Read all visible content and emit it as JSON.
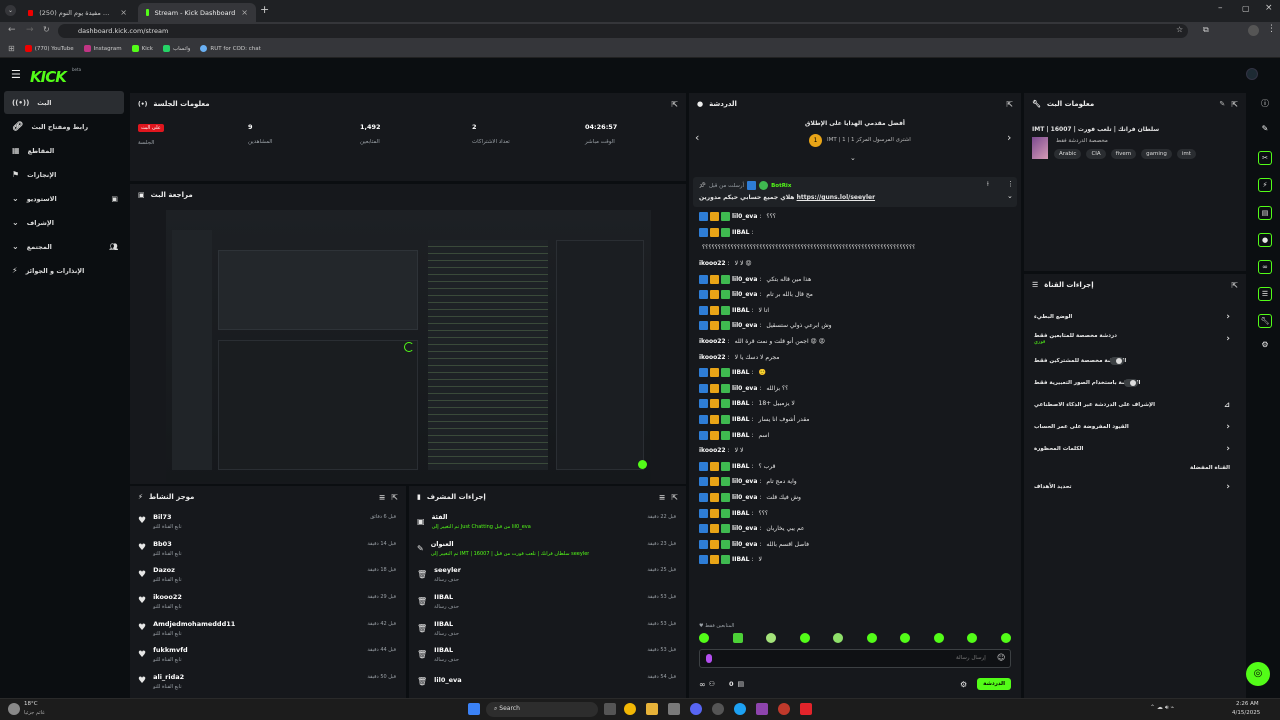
{
  "browser": {
    "tabs": [
      {
        "label": "(250) حاجات مفيدة يوم النوم | YouTube",
        "active": false
      },
      {
        "label": "Stream - Kick Dashboard",
        "active": true
      }
    ],
    "url": "dashboard.kick.com/stream",
    "bookmarks": [
      "(770) YouTube",
      "Instagram",
      "Kick",
      "واتساب",
      "RUT for COD: chat"
    ]
  },
  "app": {
    "logo": "KICK",
    "logo_sup": "beta"
  },
  "sidebar": {
    "items": [
      {
        "label": "البث",
        "icon": "broadcast-icon",
        "active": true
      },
      {
        "label": "رابط ومفتاح البث",
        "icon": "link-icon"
      },
      {
        "label": "المقاطع",
        "icon": "clip-icon"
      },
      {
        "label": "الإنجازات",
        "icon": "trophy-icon"
      },
      {
        "label": "الاستوديو",
        "icon": "studio-icon"
      },
      {
        "label": "الإشراف",
        "icon": "shield-icon"
      },
      {
        "label": "المجتمع",
        "icon": "community-icon"
      },
      {
        "label": "الإنذارات و الجوائز",
        "icon": "gift-icon"
      }
    ]
  },
  "session": {
    "title": "معلومات الجلسة",
    "live_badge": "على البث",
    "stats": [
      {
        "value": "",
        "label": "الجلسة"
      },
      {
        "value": "9",
        "label": "المشاهدين"
      },
      {
        "value": "1,492",
        "label": "المتابعين"
      },
      {
        "value": "2",
        "label": "تعداد الاشتراكات"
      },
      {
        "value": "04:26:57",
        "label": "الوقت مباشر"
      }
    ]
  },
  "preview": {
    "title": "مراجعة البث"
  },
  "activity": {
    "title": "موجز النشاط",
    "items": [
      {
        "name": "Bil73",
        "sub": "تابع القناة للتو",
        "time": "قبل 6 دقائق"
      },
      {
        "name": "Bb03",
        "sub": "تابع القناة للتو",
        "time": "قبل 14 دقيقة"
      },
      {
        "name": "Dazoz",
        "sub": "تابع القناة للتو",
        "time": "قبل 18 دقيقة"
      },
      {
        "name": "ikooo22",
        "sub": "تابع القناة للتو",
        "time": "قبل 29 دقيقة"
      },
      {
        "name": "Amdjedmohameddd11",
        "sub": "تابع القناة للتو",
        "time": "قبل 42 دقيقة"
      },
      {
        "name": "fukkmvfd",
        "sub": "تابع القناة للتو",
        "time": "قبل 44 دقيقة"
      },
      {
        "name": "ali_rida2",
        "sub": "تابع القناة للتو",
        "time": "قبل 50 دقيقة"
      }
    ]
  },
  "modactions": {
    "title": "إجراءات المشرف",
    "items": [
      {
        "name": "الفئة",
        "sub": "تم التغيير إلى Just Chatting من قبل lil0_eva",
        "time": "قبل 22 دقيقة"
      },
      {
        "name": "العنوان",
        "sub": "تم التغيير إلى IMT | 16007 | سلطان فرانك | تلعب فورت من قبل seeyler",
        "time": "قبل 23 دقيقة"
      },
      {
        "name": "seeyler",
        "sub": "حذف رسالة",
        "time": "قبل 25 دقيقة"
      },
      {
        "name": "IIBAL",
        "sub": "حذف رسالة",
        "time": "قبل 53 دقيقة"
      },
      {
        "name": "IIBAL",
        "sub": "حذف رسالة",
        "time": "قبل 53 دقيقة"
      },
      {
        "name": "IIBAL",
        "sub": "حذف رسالة",
        "time": "قبل 53 دقيقة"
      },
      {
        "name": "lil0_eva",
        "sub": "",
        "time": "قبل 54 دقيقة"
      }
    ]
  },
  "chat": {
    "title": "الدردشة",
    "top_title": "أفضل مقدمي الهدايا على الإطلاق",
    "top_sub": "IMT | 1 | اشترى المرسول المركز 1",
    "pinned_user": "BotRix",
    "pinned_by": "أرسلت من قبل",
    "pinned_text": "هلاي جميع حسابي حيكم مدورين",
    "pinned_link": "https://guns.lol/seeyler",
    "messages": [
      {
        "user": "lil0_eva",
        "text": "؟؟؟"
      },
      {
        "user": "IIBAL",
        "text": ""
      },
      {
        "user": "",
        "text": "؟؟؟؟؟؟؟؟؟؟؟؟؟؟؟؟؟؟؟؟؟؟؟؟؟؟؟؟؟؟؟؟؟؟؟؟؟؟؟؟؟؟؟؟؟؟؟؟؟؟؟؟؟؟؟؟؟؟؟؟؟؟؟؟؟؟؟"
      },
      {
        "user": "ikooo22",
        "text": "لا لا 😡",
        "plain": true
      },
      {
        "user": "lil0_eva",
        "text": "هذا مين قاله بتكي"
      },
      {
        "user": "lil0_eva",
        "text": "مح قال بالله بر تام"
      },
      {
        "user": "IIBAL",
        "text": "اتا لا"
      },
      {
        "user": "lil0_eva",
        "text": "وش ابرعي ذولي ستسقيل"
      },
      {
        "user": "ikooo22",
        "text": "اجمن أنو قلت و نمت قرة الله 😡 😡",
        "plain": true
      },
      {
        "user": "ikooo22",
        "text": "مجرم لا دسك يا لا",
        "plain": true
      },
      {
        "user": "IIBAL",
        "text": "🙂"
      },
      {
        "user": "lil0_eva",
        "text": "؟؟ بزالله"
      },
      {
        "user": "IIBAL",
        "text": "18+ لا يزمبيل"
      },
      {
        "user": "IIBAL",
        "text": "مقدر أشوف انا يسار"
      },
      {
        "user": "IIBAL",
        "text": "اسم"
      },
      {
        "user": "ikooo22",
        "text": "لا لا",
        "plain": true
      },
      {
        "user": "IIBAL",
        "text": "قرب ؟"
      },
      {
        "user": "lil0_eva",
        "text": "واية دمج تام"
      },
      {
        "user": "lil0_eva",
        "text": "وش فيك قلت"
      },
      {
        "user": "IIBAL",
        "text": "؟؟؟"
      },
      {
        "user": "lil0_eva",
        "text": "عم يبي يخاربان"
      },
      {
        "user": "lil0_eva",
        "text": "فاصل اقسم بالله"
      },
      {
        "user": "IIBAL",
        "text": "لا"
      }
    ],
    "followers_only": "المتابعين فقط",
    "input_placeholder": "إرسال رسالة",
    "send_label": "الدردشة",
    "viewers_count": "0"
  },
  "streaminfo": {
    "title": "معلومات البث",
    "stream_title": "IMT | 16007 | سلطان فرانك | تلعب فورت",
    "category": "مخصصة الدردشة فقط",
    "tags": [
      "Arabic",
      "CIA",
      "fivem",
      "gaming",
      "imt"
    ]
  },
  "channel_actions": {
    "title": "إجراءات القناة",
    "rows": [
      {
        "label": "الوضع البطيء",
        "control": "chevron"
      },
      {
        "label": "دردشة مخصصة للمتابعين فقط",
        "sub": "فوري",
        "control": "chevron"
      },
      {
        "label": "الدردشة مخصصة للمشتركين فقط",
        "control": "toggle"
      },
      {
        "label": "الدردشة باستخدام الصور التعبيرية فقط",
        "control": "toggle"
      },
      {
        "label": "الإشراف على الدردشة عبر الذكاء الاصطناعي",
        "control": "icon"
      },
      {
        "label": "القيود المفروضة على عمر الحساب",
        "control": "chevron"
      },
      {
        "label": "الكلمات المحظورة",
        "control": "chevron"
      },
      {
        "label": "القناة المفضلة",
        "control": "none"
      },
      {
        "label": "تحديد الأهداف",
        "control": "chevron"
      }
    ]
  },
  "taskbar": {
    "weather": "18°C",
    "weather_sub": "غائم جزئيا",
    "search": "Search",
    "time": "2:26 AM",
    "date": "4/15/2025"
  }
}
